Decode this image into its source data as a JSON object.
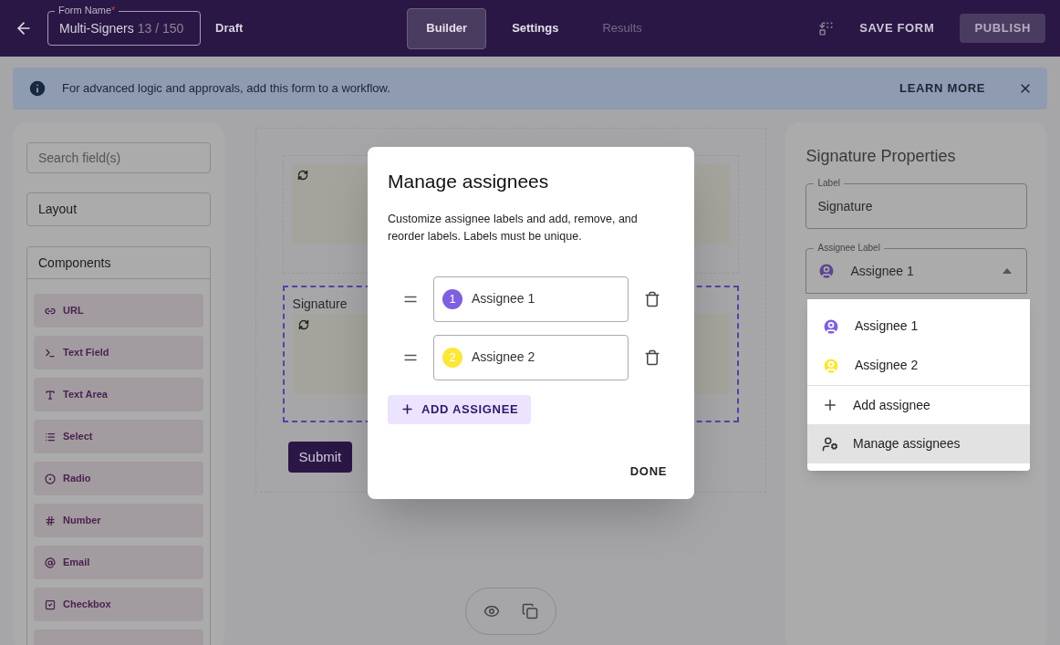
{
  "header": {
    "field_label": "Form Name",
    "required_mark": "*",
    "form_name": "Multi-Signers",
    "char_count": "13 / 150",
    "status": "Draft",
    "tabs": [
      {
        "label": "Builder",
        "selected": true,
        "disabled": false
      },
      {
        "label": "Settings",
        "selected": false,
        "disabled": false
      },
      {
        "label": "Results",
        "selected": false,
        "disabled": true
      }
    ],
    "save": "SAVE FORM",
    "publish": "PUBLISH"
  },
  "banner": {
    "text": "For advanced logic and approvals, add this form to a workflow.",
    "action": "LEARN MORE"
  },
  "sidebar": {
    "search_placeholder": "Search field(s)",
    "layout": "Layout",
    "components_title": "Components",
    "components": [
      {
        "kind": "url",
        "label": "URL"
      },
      {
        "kind": "text_field",
        "label": "Text Field"
      },
      {
        "kind": "text_area",
        "label": "Text Area"
      },
      {
        "kind": "select",
        "label": "Select"
      },
      {
        "kind": "radio",
        "label": "Radio"
      },
      {
        "kind": "number",
        "label": "Number"
      },
      {
        "kind": "email",
        "label": "Email"
      },
      {
        "kind": "checkbox",
        "label": "Checkbox"
      }
    ]
  },
  "canvas": {
    "field_label": "Signature",
    "submit": "Submit"
  },
  "properties": {
    "title": "Signature Properties",
    "label_field": {
      "label": "Label",
      "value": "Signature"
    },
    "assignee_field": {
      "label": "Assignee Label",
      "value": "Assignee 1",
      "color": "#5b4790",
      "expanded": true
    }
  },
  "dropdown": {
    "items": [
      {
        "kind": "assignee",
        "label": "Assignee 1",
        "color": "#7e5fe0",
        "selected": false
      },
      {
        "kind": "assignee",
        "label": "Assignee 2",
        "color": "#fbe73a",
        "selected": false
      },
      {
        "kind": "add",
        "label": "Add assignee",
        "selected": false
      },
      {
        "kind": "manage",
        "label": "Manage assignees",
        "selected": true
      }
    ]
  },
  "modal": {
    "title": "Manage assignees",
    "description": "Customize assignee labels and add, remove, and reorder labels. Labels must be unique.",
    "assignees": [
      {
        "number": "1",
        "value": "Assignee 1",
        "color": "#7e5fe0"
      },
      {
        "number": "2",
        "value": "Assignee 2",
        "color": "#fbe73a"
      }
    ],
    "add_button": "ADD ASSIGNEE",
    "done": "DONE"
  }
}
